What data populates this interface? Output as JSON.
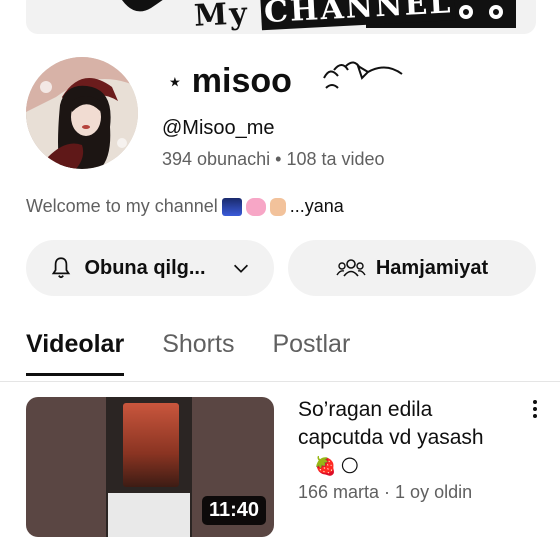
{
  "banner": {
    "text_part1": "My ",
    "text_part2": "CHANNEL"
  },
  "channel": {
    "name": "misoo",
    "star": "⋆",
    "handle": "@Misoo_me",
    "subscribers": "394 obunachi",
    "separator": "•",
    "videos": "108 ta video",
    "description": "Welcome to my channel",
    "description_more": "...yana"
  },
  "buttons": {
    "subscribe_label": "Obuna qilg...",
    "community_label": "Hamjamiyat"
  },
  "tabs": [
    {
      "label": "Videolar",
      "active": true
    },
    {
      "label": "Shorts",
      "active": false
    },
    {
      "label": "Postlar",
      "active": false
    }
  ],
  "video": {
    "title": "So’ragan edila capcutda vd yasash",
    "duration": "11:40",
    "meta": "166 marta · 1 oy oldin",
    "emojis": [
      "🍓",
      "🌕"
    ]
  },
  "icons": {
    "subscribe": "bell-icon",
    "subscribe_dropdown": "chevron-down-icon",
    "community": "people-icon",
    "more": "more-vertical-icon"
  },
  "colors": {
    "text_primary": "#0f0f0f",
    "text_secondary": "#606060",
    "button_bg": "#f2f2f2"
  }
}
